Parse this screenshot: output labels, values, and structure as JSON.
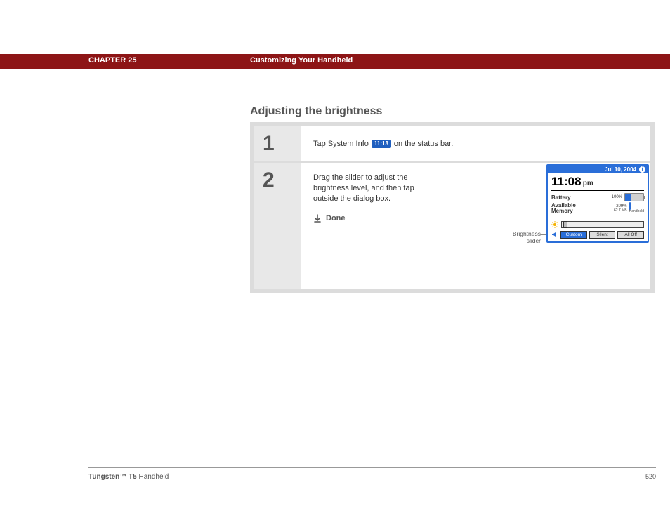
{
  "header": {
    "chapter": "CHAPTER 25",
    "title": "Customizing Your Handheld"
  },
  "section_heading": "Adjusting the brightness",
  "steps": {
    "one": {
      "num": "1",
      "pre": "Tap System Info",
      "badge": "11:13",
      "post": "on the status bar."
    },
    "two": {
      "num": "2",
      "text": "Drag the slider to adjust the brightness level, and then tap outside the dialog box.",
      "done": "Done"
    }
  },
  "callout": "Brightness\nslider",
  "device": {
    "date": "Jul 10, 2004",
    "info_glyph": "i",
    "time": "11:08",
    "pm": "pm",
    "battery_label": "Battery",
    "battery_pct": "100%",
    "memory_label": "Available\nMemory",
    "memory_pct": "209%",
    "memory_size": "62.7 MB",
    "memory_sub": "Handheld",
    "segs": {
      "custom": "Custom",
      "silent": "Silent",
      "alloff": "All Off"
    }
  },
  "footer": {
    "product_bold": "Tungsten™ T5",
    "product_rest": " Handheld",
    "page": "520"
  }
}
